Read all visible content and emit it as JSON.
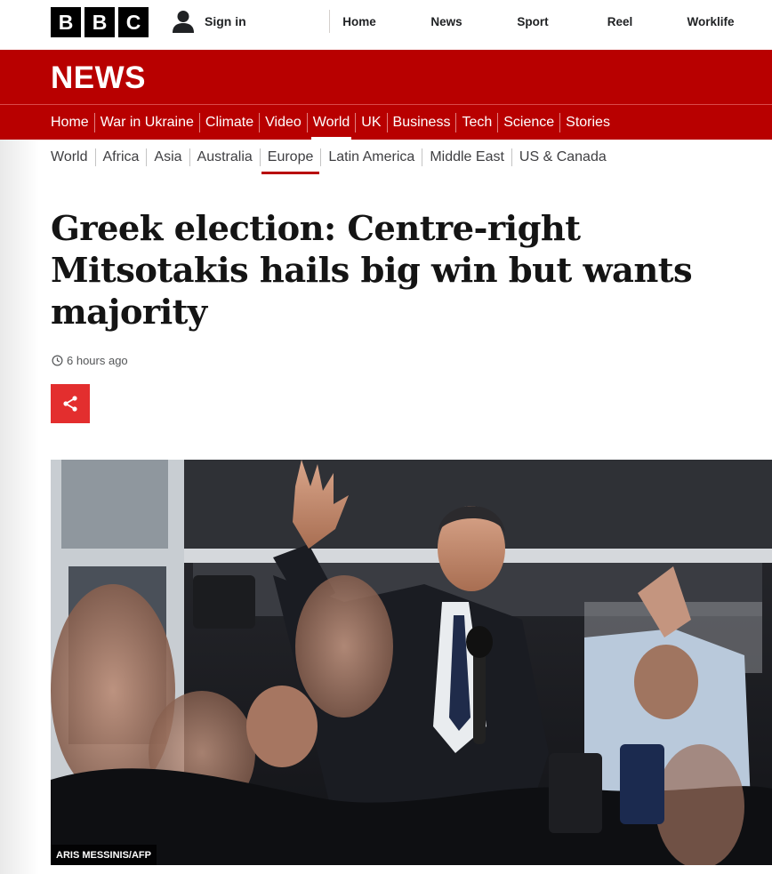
{
  "brand": {
    "logo_letters": [
      "B",
      "B",
      "C"
    ],
    "section_title": "NEWS",
    "color_primary": "#b80000",
    "color_share": "#e32e2e"
  },
  "header": {
    "signin_label": "Sign in",
    "nav": [
      "Home",
      "News",
      "Sport",
      "Reel",
      "Worklife"
    ]
  },
  "main_nav": {
    "items": [
      "Home",
      "War in Ukraine",
      "Climate",
      "Video",
      "World",
      "UK",
      "Business",
      "Tech",
      "Science",
      "Stories"
    ],
    "active": "World"
  },
  "sub_nav": {
    "items": [
      "World",
      "Africa",
      "Asia",
      "Australia",
      "Europe",
      "Latin America",
      "Middle East",
      "US & Canada"
    ],
    "active": "Europe"
  },
  "article": {
    "headline": "Greek election: Centre-right Mitsotakis hails big win but wants majority",
    "timestamp": "6 hours ago",
    "image_credit": "ARIS MESSINIS/AFP"
  }
}
